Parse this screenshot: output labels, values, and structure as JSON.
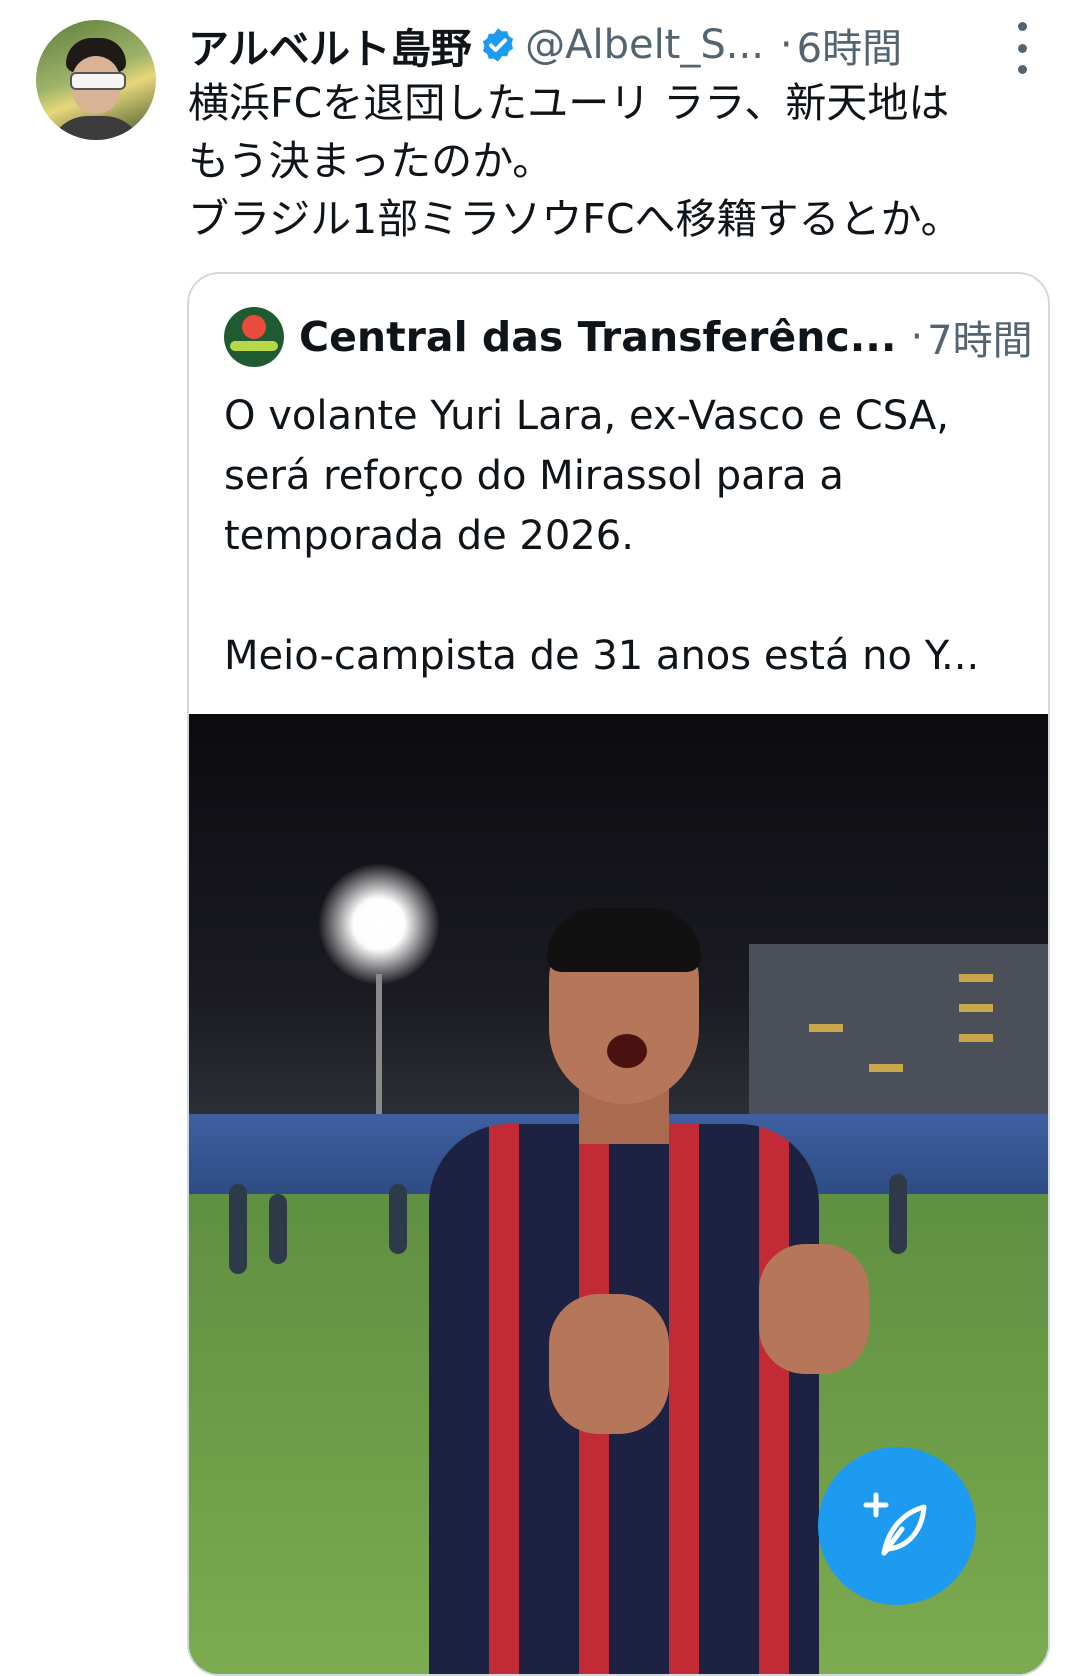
{
  "tweet": {
    "author_name": "アルベルト島野",
    "handle": "@Albelt_S...",
    "separator": "·",
    "time": "6時間",
    "text_lines": [
      "横浜FCを退団したユーリ ララ、新天地は",
      "もう決まったのか。",
      "ブラジル1部ミラソウFCへ移籍するとか。"
    ]
  },
  "quote": {
    "author_name": "Central das Transferênc...",
    "separator": "·",
    "time": "7時間",
    "text_lines": [
      "O volante Yuri Lara, ex-Vasco e CSA,",
      "será reforço do Mirassol para a",
      "temporada de 2026.",
      "",
      "Meio-campista de 31 anos está no Y..."
    ]
  },
  "colors": {
    "accent": "#1d9bf0",
    "secondary_text": "#536471",
    "border": "#cfd9de"
  },
  "icons": {
    "verified": "verified-badge-icon",
    "more": "more-vertical-icon",
    "compose": "compose-post-icon"
  }
}
